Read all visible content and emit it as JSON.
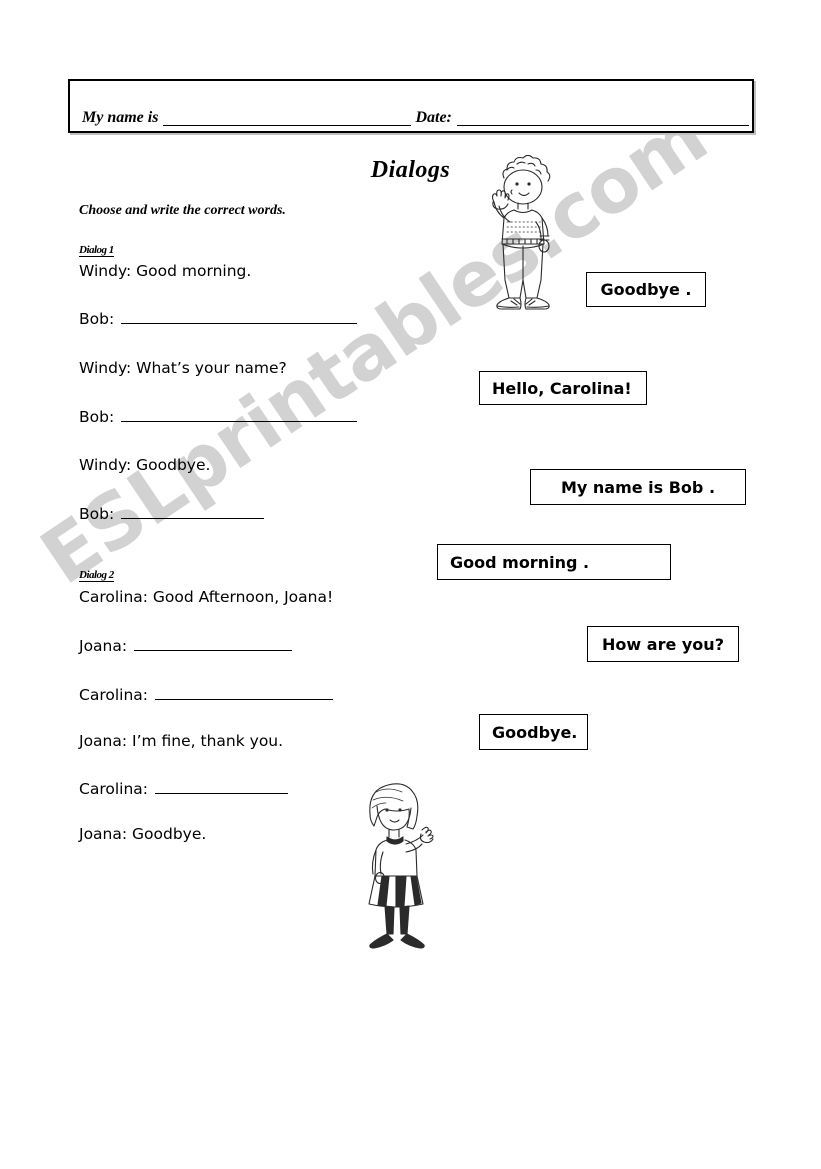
{
  "worksheet": {
    "title": "Dialogs",
    "instruction": "Choose and write the correct words.",
    "watermark": "ESLprintables.com"
  },
  "header": {
    "name_label": "My name is",
    "date_label": "Date:"
  },
  "dialogs": [
    {
      "label": "Dialog 1",
      "lines": [
        {
          "speaker": "Windy: Good morning.",
          "blank": false
        },
        {
          "speaker": "Bob:",
          "blank": true,
          "blank_width": 236
        },
        {
          "speaker": "Windy: What’s your name?",
          "blank": false
        },
        {
          "speaker": "Bob:",
          "blank": true,
          "blank_width": 236
        },
        {
          "speaker": "Windy: Goodbye.",
          "blank": false
        },
        {
          "speaker": "Bob:",
          "blank": true,
          "blank_width": 143
        }
      ]
    },
    {
      "label": "Dialog 2",
      "lines": [
        {
          "speaker": "Carolina: Good Afternoon, Joana!",
          "blank": false
        },
        {
          "speaker": "Joana:",
          "blank": true,
          "blank_width": 158
        },
        {
          "speaker": "Carolina:",
          "blank": true,
          "blank_width": 178
        },
        {
          "speaker": "Joana: I’m fine, thank you.",
          "blank": false
        },
        {
          "speaker": "Carolina:",
          "blank": true,
          "blank_width": 133
        },
        {
          "speaker": "Joana: Goodbye.",
          "blank": false
        }
      ]
    }
  ],
  "answers": [
    {
      "text": "Goodbye .",
      "align": "center"
    },
    {
      "text": "Hello, Carolina!",
      "align": "left"
    },
    {
      "text": "My name is Bob .",
      "align": "center"
    },
    {
      "text": "Good morning .",
      "align": "left"
    },
    {
      "text": "How are you?",
      "align": "center"
    },
    {
      "text": "Goodbye.",
      "align": "left"
    }
  ],
  "illustrations": [
    {
      "name": "boy-waving"
    },
    {
      "name": "girl-waving"
    }
  ]
}
